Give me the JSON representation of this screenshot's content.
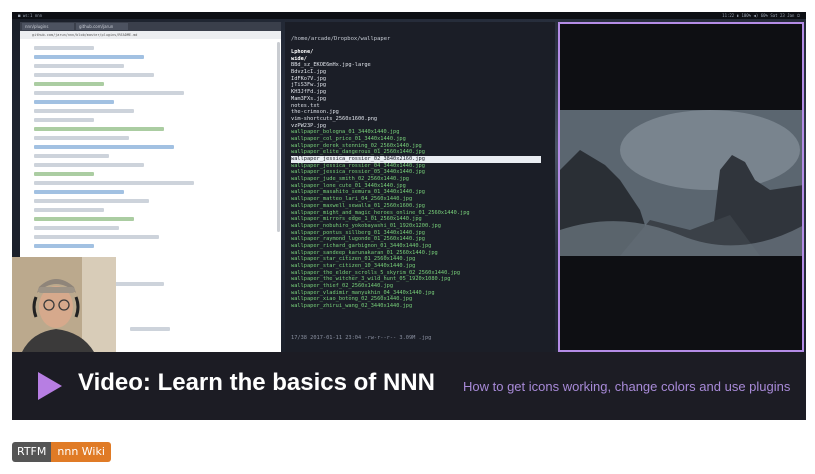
{
  "colors": {
    "accent": "#b77ee3",
    "subtitle": "#a88ad8",
    "badge_left": "#555555",
    "badge_right": "#e07b26"
  },
  "video": {
    "title": "Video: Learn the basics of NNN",
    "subtitle": "How to get icons working, change colors and use plugins",
    "play_icon": "play-icon"
  },
  "screen": {
    "topbar_left": "■ ws:1  nnn  ",
    "topbar_right": "11:22  ▮ 100%  ◀) 60%  Sat 23 Jan  ⏻",
    "editor": {
      "tabs": [
        "nnn/plugins",
        "github.com/jarun"
      ],
      "url": "github.com/jarun/nnn/blob/master/plugins/README.md"
    },
    "terminal": {
      "path": "/home/arcade/Dropbox/wallpaper",
      "files": [
        {
          "name": "Lphone/",
          "kind": "dir"
        },
        {
          "name": "wide/",
          "kind": "dir"
        },
        {
          "name": "BBd_sz_EKOE6mHx.jpg-large",
          "kind": "img"
        },
        {
          "name": "Bdvz1cI.jpg",
          "kind": "img"
        },
        {
          "name": "IdFKo7V.jpg",
          "kind": "img"
        },
        {
          "name": "jTiS3Fw.jpg",
          "kind": "img"
        },
        {
          "name": "KH3JfFd.jpg",
          "kind": "img"
        },
        {
          "name": "Mam3FXs.jpg",
          "kind": "img"
        },
        {
          "name": "notes.txt",
          "kind": "img"
        },
        {
          "name": "the-crimson.jpg",
          "kind": "img"
        },
        {
          "name": "vim-shortcuts_2560x1600.png",
          "kind": "img"
        },
        {
          "name": "vzPW23P.jpg",
          "kind": "img"
        },
        {
          "name": "wallpaper_bologna_01_3440x1440.jpg",
          "kind": "green"
        },
        {
          "name": "wallpaper_col_price_01_3440x1440.jpg",
          "kind": "green"
        },
        {
          "name": "wallpaper_derek_stenning_02_2560x1440.jpg",
          "kind": "green"
        },
        {
          "name": "wallpaper_elite_dangerous_01_2560x1440.jpg",
          "kind": "green"
        },
        {
          "name": "wallpaper_jessica_rossier_02_3840x2160.jpg",
          "kind": "sel"
        },
        {
          "name": "wallpaper_jessica_rossier_04_3440x1440.jpg",
          "kind": "green"
        },
        {
          "name": "wallpaper_jessica_rossier_05_3440x1440.jpg",
          "kind": "green"
        },
        {
          "name": "wallpaper_jude_smith_02_2560x1440.jpg",
          "kind": "green"
        },
        {
          "name": "wallpaper_lone_cute_01_3440x1440.jpg",
          "kind": "green"
        },
        {
          "name": "wallpaper_masahito_semura_01_3440x1440.jpg",
          "kind": "green"
        },
        {
          "name": "wallpaper_matteo_lari_04_2560x1440.jpg",
          "kind": "green"
        },
        {
          "name": "wallpaper_maxwell_sewalla_01_2560x1600.jpg",
          "kind": "green"
        },
        {
          "name": "wallpaper_might_and_magic_heroes_online_01_2560x1440.jpg",
          "kind": "green"
        },
        {
          "name": "wallpaper_mirrors_edge_1_01_2560x1440.jpg",
          "kind": "green"
        },
        {
          "name": "wallpaper_nobuhiro_yokobayashi_01_1920x1200.jpg",
          "kind": "green"
        },
        {
          "name": "wallpaper_pontus_sillberg_01_3440x1440.jpg",
          "kind": "green"
        },
        {
          "name": "wallpaper_raymond_lugonde_01_2560x1440.jpg",
          "kind": "green"
        },
        {
          "name": "wallpaper_richard_garbignon_01_3440x1440.jpg",
          "kind": "green"
        },
        {
          "name": "wallpaper_sandeep_karunakaran_01_2560x1440.jpg",
          "kind": "green"
        },
        {
          "name": "wallpaper_star_citizen_01_2560x1440.jpg",
          "kind": "green"
        },
        {
          "name": "wallpaper_star_citizen_10_3440x1440.jpg",
          "kind": "green"
        },
        {
          "name": "wallpaper_the_elder_scrolls_5_skyrim_02_2560x1440.jpg",
          "kind": "green"
        },
        {
          "name": "wallpaper_the_witcher_3_wild_hunt_05_1920x1080.jpg",
          "kind": "green"
        },
        {
          "name": "wallpaper_thief_02_2560x1440.jpg",
          "kind": "green"
        },
        {
          "name": "wallpaper_vladimir_manyukhin_04_3440x1440.jpg",
          "kind": "green"
        },
        {
          "name": "wallpaper_xiao_botong_02_2560x1440.jpg",
          "kind": "green"
        },
        {
          "name": "wallpaper_zhirui_wang_02_3440x1440.jpg",
          "kind": "green"
        }
      ],
      "status": "17/38 2017-01-11 23:04 -rw-r--r-- 3.09M .jpg"
    }
  },
  "badge": {
    "left": "RTFM",
    "right": "nnn Wiki"
  }
}
